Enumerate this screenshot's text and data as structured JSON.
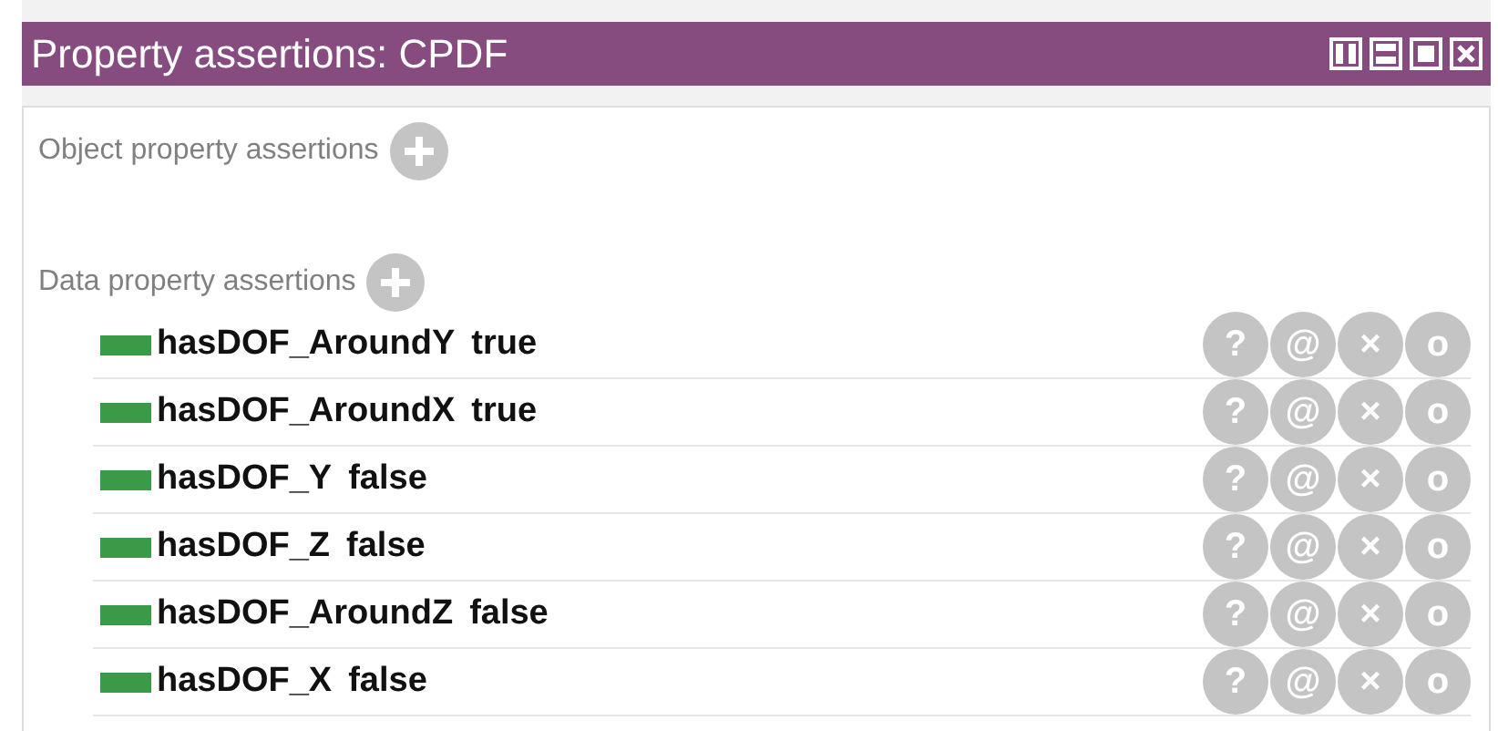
{
  "window": {
    "title": "Property assertions: CPDF"
  },
  "sections": [
    {
      "label": "Object property assertions"
    },
    {
      "label": "Data property assertions",
      "rows": [
        {
          "property": "hasDOF_AroundY",
          "value": "true",
          "actions": [
            "?",
            "@",
            "×",
            "o"
          ]
        },
        {
          "property": "hasDOF_AroundX",
          "value": "true",
          "actions": [
            "?",
            "@",
            "×",
            "o"
          ]
        },
        {
          "property": "hasDOF_Y",
          "value": "false",
          "actions": [
            "?",
            "@",
            "×",
            "o"
          ]
        },
        {
          "property": "hasDOF_Z",
          "value": "false",
          "actions": [
            "?",
            "@",
            "×",
            "o"
          ]
        },
        {
          "property": "hasDOF_AroundZ",
          "value": "false",
          "actions": [
            "?",
            "@",
            "×",
            "o"
          ]
        },
        {
          "property": "hasDOF_X",
          "value": "false",
          "actions": [
            "?",
            "@",
            "×",
            "o"
          ]
        }
      ]
    }
  ]
}
